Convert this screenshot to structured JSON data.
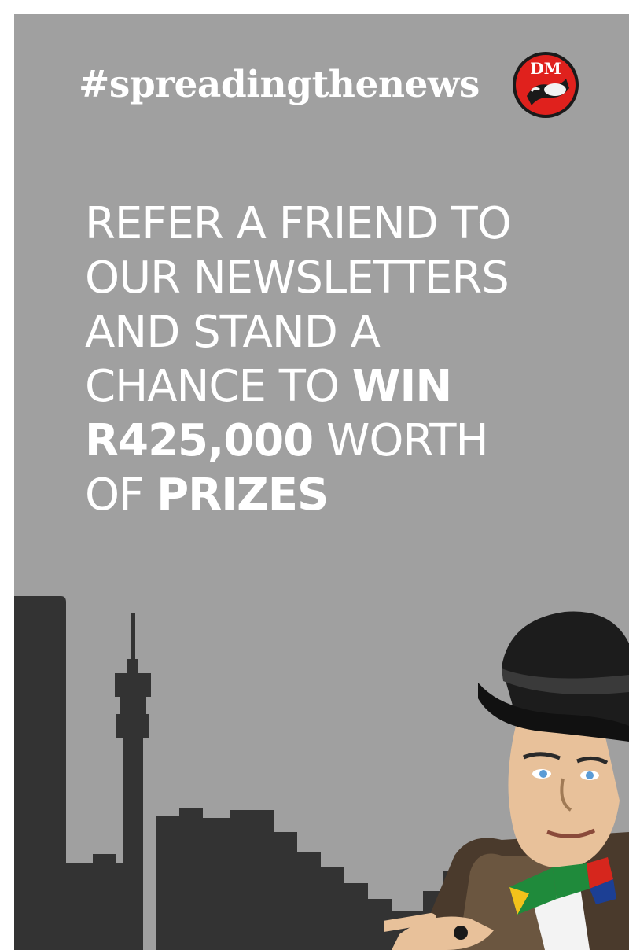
{
  "banner": {
    "hashtag": "#spreadingthenews",
    "logo": {
      "text": "DM",
      "icon": "daily-maverick-logo-icon",
      "color": "#e0211d"
    },
    "headline": {
      "line1": "REFER A FRIEND TO",
      "line2": "OUR NEWSLETTERS",
      "line3": "AND STAND A",
      "line4_plain": "CHANCE TO ",
      "line4_bold": "WIN",
      "line5_bold": "R425,000",
      "line5_plain": " WORTH",
      "line6_plain": "OF ",
      "line6_bold": "PRIZES"
    },
    "illustration": {
      "skyline": "johannesburg-skyline-icon",
      "figure": "man-in-hat-with-flag-bowtie-icon"
    },
    "colors": {
      "background": "#a0a0a0",
      "skyline": "#333333",
      "text": "#ffffff"
    }
  }
}
